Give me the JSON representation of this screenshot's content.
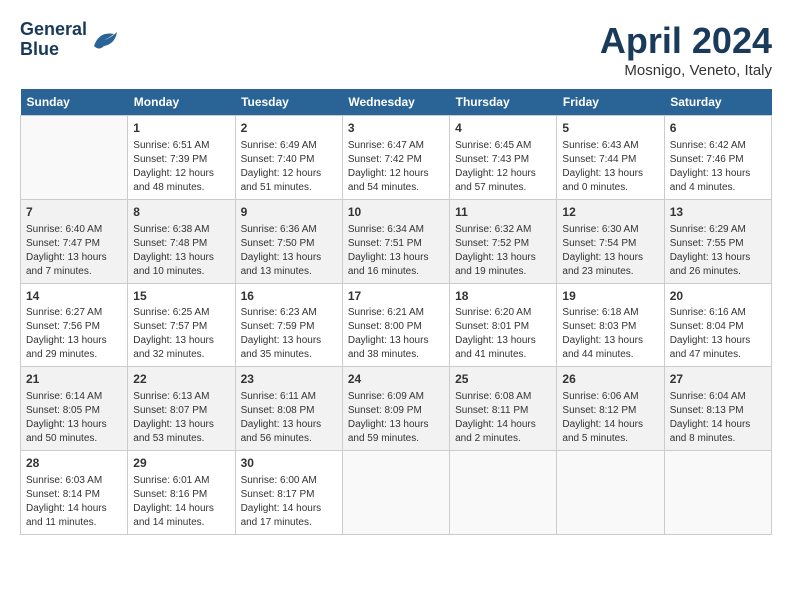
{
  "header": {
    "logo_line1": "General",
    "logo_line2": "Blue",
    "title": "April 2024",
    "location": "Mosnigo, Veneto, Italy"
  },
  "calendar": {
    "days_of_week": [
      "Sunday",
      "Monday",
      "Tuesday",
      "Wednesday",
      "Thursday",
      "Friday",
      "Saturday"
    ],
    "weeks": [
      [
        {
          "num": "",
          "info": ""
        },
        {
          "num": "1",
          "info": "Sunrise: 6:51 AM\nSunset: 7:39 PM\nDaylight: 12 hours\nand 48 minutes."
        },
        {
          "num": "2",
          "info": "Sunrise: 6:49 AM\nSunset: 7:40 PM\nDaylight: 12 hours\nand 51 minutes."
        },
        {
          "num": "3",
          "info": "Sunrise: 6:47 AM\nSunset: 7:42 PM\nDaylight: 12 hours\nand 54 minutes."
        },
        {
          "num": "4",
          "info": "Sunrise: 6:45 AM\nSunset: 7:43 PM\nDaylight: 12 hours\nand 57 minutes."
        },
        {
          "num": "5",
          "info": "Sunrise: 6:43 AM\nSunset: 7:44 PM\nDaylight: 13 hours\nand 0 minutes."
        },
        {
          "num": "6",
          "info": "Sunrise: 6:42 AM\nSunset: 7:46 PM\nDaylight: 13 hours\nand 4 minutes."
        }
      ],
      [
        {
          "num": "7",
          "info": "Sunrise: 6:40 AM\nSunset: 7:47 PM\nDaylight: 13 hours\nand 7 minutes."
        },
        {
          "num": "8",
          "info": "Sunrise: 6:38 AM\nSunset: 7:48 PM\nDaylight: 13 hours\nand 10 minutes."
        },
        {
          "num": "9",
          "info": "Sunrise: 6:36 AM\nSunset: 7:50 PM\nDaylight: 13 hours\nand 13 minutes."
        },
        {
          "num": "10",
          "info": "Sunrise: 6:34 AM\nSunset: 7:51 PM\nDaylight: 13 hours\nand 16 minutes."
        },
        {
          "num": "11",
          "info": "Sunrise: 6:32 AM\nSunset: 7:52 PM\nDaylight: 13 hours\nand 19 minutes."
        },
        {
          "num": "12",
          "info": "Sunrise: 6:30 AM\nSunset: 7:54 PM\nDaylight: 13 hours\nand 23 minutes."
        },
        {
          "num": "13",
          "info": "Sunrise: 6:29 AM\nSunset: 7:55 PM\nDaylight: 13 hours\nand 26 minutes."
        }
      ],
      [
        {
          "num": "14",
          "info": "Sunrise: 6:27 AM\nSunset: 7:56 PM\nDaylight: 13 hours\nand 29 minutes."
        },
        {
          "num": "15",
          "info": "Sunrise: 6:25 AM\nSunset: 7:57 PM\nDaylight: 13 hours\nand 32 minutes."
        },
        {
          "num": "16",
          "info": "Sunrise: 6:23 AM\nSunset: 7:59 PM\nDaylight: 13 hours\nand 35 minutes."
        },
        {
          "num": "17",
          "info": "Sunrise: 6:21 AM\nSunset: 8:00 PM\nDaylight: 13 hours\nand 38 minutes."
        },
        {
          "num": "18",
          "info": "Sunrise: 6:20 AM\nSunset: 8:01 PM\nDaylight: 13 hours\nand 41 minutes."
        },
        {
          "num": "19",
          "info": "Sunrise: 6:18 AM\nSunset: 8:03 PM\nDaylight: 13 hours\nand 44 minutes."
        },
        {
          "num": "20",
          "info": "Sunrise: 6:16 AM\nSunset: 8:04 PM\nDaylight: 13 hours\nand 47 minutes."
        }
      ],
      [
        {
          "num": "21",
          "info": "Sunrise: 6:14 AM\nSunset: 8:05 PM\nDaylight: 13 hours\nand 50 minutes."
        },
        {
          "num": "22",
          "info": "Sunrise: 6:13 AM\nSunset: 8:07 PM\nDaylight: 13 hours\nand 53 minutes."
        },
        {
          "num": "23",
          "info": "Sunrise: 6:11 AM\nSunset: 8:08 PM\nDaylight: 13 hours\nand 56 minutes."
        },
        {
          "num": "24",
          "info": "Sunrise: 6:09 AM\nSunset: 8:09 PM\nDaylight: 13 hours\nand 59 minutes."
        },
        {
          "num": "25",
          "info": "Sunrise: 6:08 AM\nSunset: 8:11 PM\nDaylight: 14 hours\nand 2 minutes."
        },
        {
          "num": "26",
          "info": "Sunrise: 6:06 AM\nSunset: 8:12 PM\nDaylight: 14 hours\nand 5 minutes."
        },
        {
          "num": "27",
          "info": "Sunrise: 6:04 AM\nSunset: 8:13 PM\nDaylight: 14 hours\nand 8 minutes."
        }
      ],
      [
        {
          "num": "28",
          "info": "Sunrise: 6:03 AM\nSunset: 8:14 PM\nDaylight: 14 hours\nand 11 minutes."
        },
        {
          "num": "29",
          "info": "Sunrise: 6:01 AM\nSunset: 8:16 PM\nDaylight: 14 hours\nand 14 minutes."
        },
        {
          "num": "30",
          "info": "Sunrise: 6:00 AM\nSunset: 8:17 PM\nDaylight: 14 hours\nand 17 minutes."
        },
        {
          "num": "",
          "info": ""
        },
        {
          "num": "",
          "info": ""
        },
        {
          "num": "",
          "info": ""
        },
        {
          "num": "",
          "info": ""
        }
      ]
    ]
  }
}
